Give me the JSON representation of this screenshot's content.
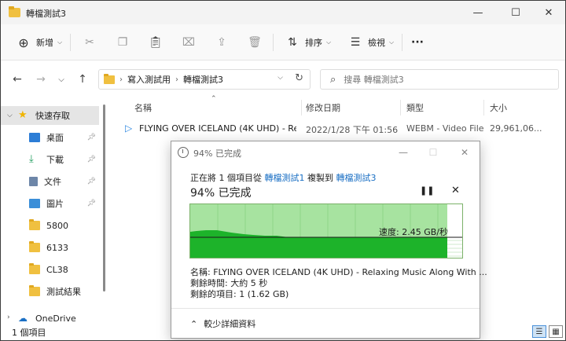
{
  "window": {
    "title": "轉檔測試3"
  },
  "toolbar": {
    "new_label": "新增",
    "sort_label": "排序",
    "view_label": "檢視",
    "more_label": "···"
  },
  "address": {
    "crumbs": [
      "寫入測試用",
      "轉檔測試3"
    ],
    "search_placeholder": "搜尋 轉檔測試3"
  },
  "sidebar": {
    "items": [
      {
        "label": "快速存取",
        "icon": "star-icon"
      },
      {
        "label": "桌面",
        "icon": "desktop-icon"
      },
      {
        "label": "下載",
        "icon": "download-icon"
      },
      {
        "label": "文件",
        "icon": "document-icon"
      },
      {
        "label": "圖片",
        "icon": "picture-icon"
      },
      {
        "label": "5800",
        "icon": "folder-icon"
      },
      {
        "label": "6133",
        "icon": "folder-icon"
      },
      {
        "label": "CL38",
        "icon": "folder-icon"
      },
      {
        "label": "測試結果",
        "icon": "folder-icon"
      },
      {
        "label": "OneDrive",
        "icon": "cloud-icon"
      }
    ]
  },
  "columns": {
    "name": "名稱",
    "modified": "修改日期",
    "type": "類型",
    "size": "大小"
  },
  "files": [
    {
      "name": "FLYING OVER ICELAND (4K UHD) - Rel...",
      "modified": "2022/1/28 下午 01:56",
      "type": "WEBM - Video File",
      "size": "29,961,06..."
    }
  ],
  "status": {
    "count": "1 個項目"
  },
  "dialog": {
    "title": "94% 已完成",
    "line_prefix": "正在將 1 個項目從",
    "source": "轉檔測試1",
    "line_mid": "複製到",
    "destination": "轉檔測試3",
    "percent_text": "94% 已完成",
    "progress": 0.94,
    "speed": "速度: 2.45 GB/秒",
    "name_line": "名稱: FLYING OVER ICELAND (4K UHD) - Relaxing Music Along With ...",
    "time_line": "剩餘時間: 大約 5 秒",
    "items_line": "剩餘的項目: 1 (1.62 GB)",
    "footer": "較少詳細資料",
    "colors": {
      "graph_fill": "#1db32a",
      "graph_bg": "#a7e3a0",
      "link": "#1a6fc4"
    }
  }
}
